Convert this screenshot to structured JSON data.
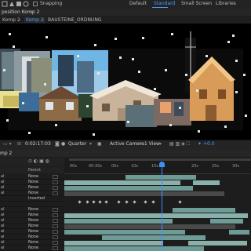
{
  "toolbar": {
    "snapping_label": "Snapping",
    "workspaces": [
      "Default",
      "Standard",
      "Small Screen",
      "Libraries"
    ],
    "active_workspace": "Standard"
  },
  "comp_panel": {
    "title": "position Komp 2",
    "menu_icon": "hamburger-menu-icon",
    "breadcrumbs": [
      "Komp 2",
      "Komp 2",
      "BAUSTEINE_ORDNUNG"
    ]
  },
  "viewer_controls": {
    "timecode": "0:02:17:03",
    "resolution": "Quarter",
    "camera": "Active Camera",
    "views": "1 View",
    "exposure": "+0.0"
  },
  "timeline": {
    "tab_label": "mp 2",
    "parent_header": "Parent",
    "ruler_ticks": [
      "00s",
      "00:30s",
      "05s",
      "10s",
      "15s",
      "20s",
      "25s",
      "30s"
    ],
    "layer_rows": [
      {
        "idx": "al",
        "parent": "None"
      },
      {
        "idx": "al",
        "parent": "None"
      },
      {
        "idx": "al",
        "parent": "None"
      },
      {
        "idx": "al",
        "parent": "None"
      },
      {
        "idx": "",
        "parent": "Inverted"
      },
      {
        "idx": "",
        "parent": ""
      },
      {
        "idx": "al",
        "parent": "None"
      },
      {
        "idx": "al",
        "parent": "None"
      },
      {
        "idx": "al",
        "parent": "None"
      },
      {
        "idx": "al",
        "parent": "None"
      },
      {
        "idx": "al",
        "parent": "None"
      },
      {
        "idx": "al",
        "parent": "None"
      },
      {
        "idx": "al",
        "parent": "None"
      },
      {
        "idx": "al",
        "parent": "None"
      }
    ]
  },
  "colors": {
    "accent": "#3f8fff",
    "track_bar": "#6e9b96",
    "panel_bg": "#1d1d1d"
  }
}
